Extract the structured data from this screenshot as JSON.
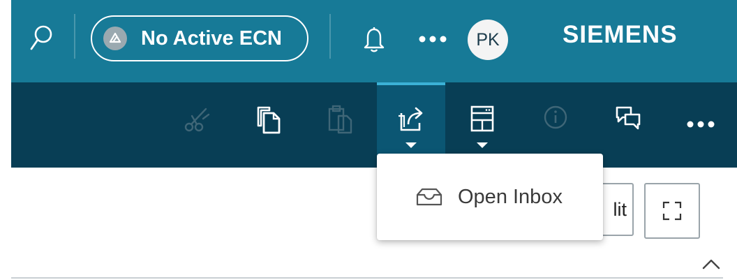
{
  "header": {
    "search_icon": "search-icon",
    "ecn_label": "No Active ECN",
    "notification_icon": "bell-icon",
    "more_icon": "more-horizontal-icon",
    "avatar_initials": "PK",
    "brand": "SIEMENS",
    "background_color": "#177a97"
  },
  "toolbar": {
    "background_color": "#083e55",
    "active_color": "#0b5673",
    "buttons": [
      {
        "icon": "cut-icon",
        "enabled": false
      },
      {
        "icon": "copy-icon",
        "enabled": true
      },
      {
        "icon": "paste-icon",
        "enabled": false
      },
      {
        "icon": "open-share-icon",
        "enabled": true,
        "active": true,
        "has_menu": true
      },
      {
        "icon": "layout-icon",
        "enabled": true,
        "has_menu": true
      },
      {
        "icon": "info-icon",
        "enabled": false
      },
      {
        "icon": "chat-icon",
        "enabled": true
      },
      {
        "icon": "more-horizontal-icon",
        "enabled": true
      }
    ]
  },
  "dropdown": {
    "items": [
      {
        "label": "Open Inbox",
        "icon": "inbox-icon"
      }
    ]
  },
  "content": {
    "edit_button_partial": "lit",
    "fullscreen_icon": "fullscreen-icon",
    "collapse_icon": "chevron-up-icon"
  }
}
